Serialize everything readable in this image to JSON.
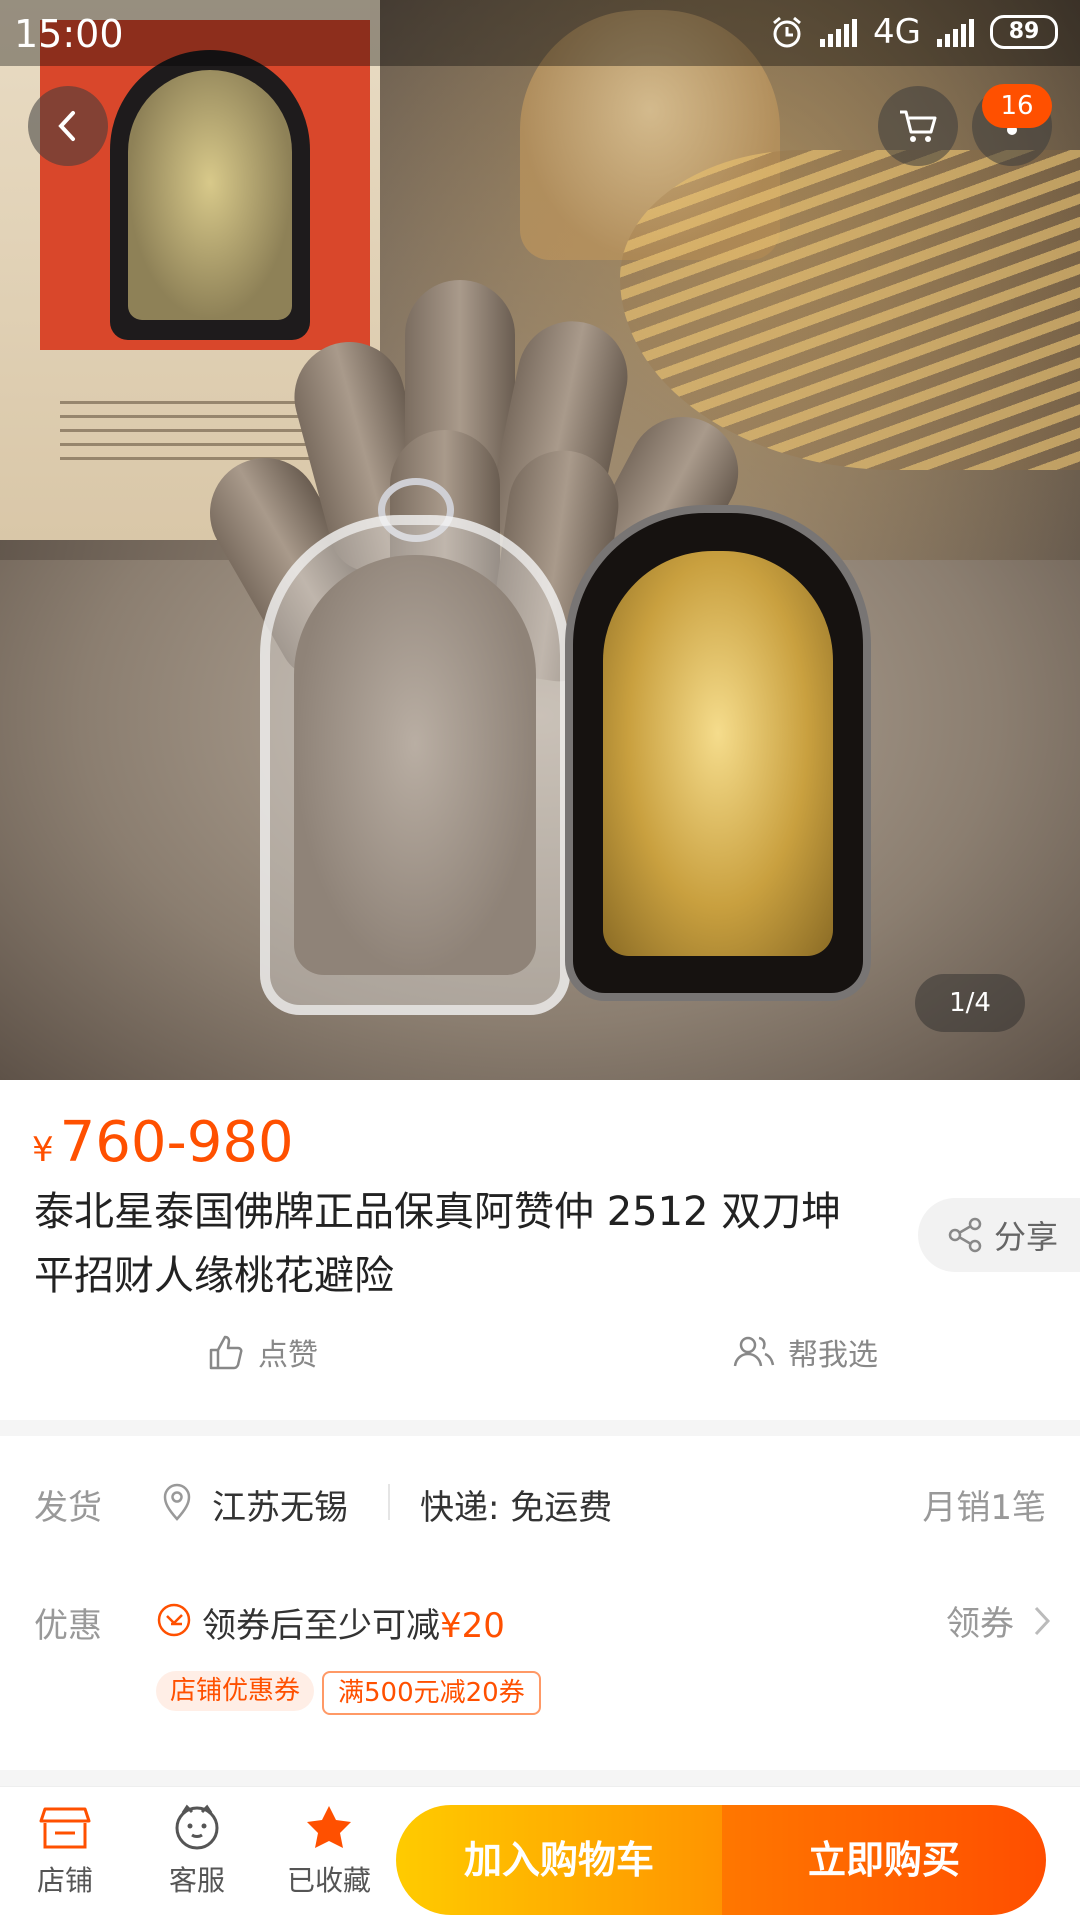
{
  "status_bar": {
    "time": "15:00",
    "network": "4G",
    "battery": "89"
  },
  "header": {
    "cart_badge": "16"
  },
  "gallery": {
    "pager": "1/4"
  },
  "product": {
    "price_symbol": "¥",
    "price": "760-980",
    "title": "泰北星泰国佛牌正品保真阿赞仲 2512 双刀坤平招财人缘桃花避险",
    "share_label": "分享",
    "like_label": "点赞",
    "help_choose_label": "帮我选"
  },
  "shipping": {
    "label": "发货",
    "location": "江苏无锡",
    "express": "快递: 免运费",
    "monthly_sales": "月销1笔"
  },
  "promo": {
    "label": "优惠",
    "text": "领券后至少可减",
    "amount": "¥20",
    "get_coupon": "领券",
    "tags": [
      "店铺优惠券",
      "满500元减20券"
    ]
  },
  "bottom_bar": {
    "store": "店铺",
    "service": "客服",
    "favorited": "已收藏",
    "add_to_cart": "加入购物车",
    "buy_now": "立即购买"
  },
  "colors": {
    "accent": "#ff5000",
    "cart_gradient": [
      "#ffcb00",
      "#ff9400"
    ],
    "buy_gradient": [
      "#ff7700",
      "#ff4e00"
    ]
  }
}
